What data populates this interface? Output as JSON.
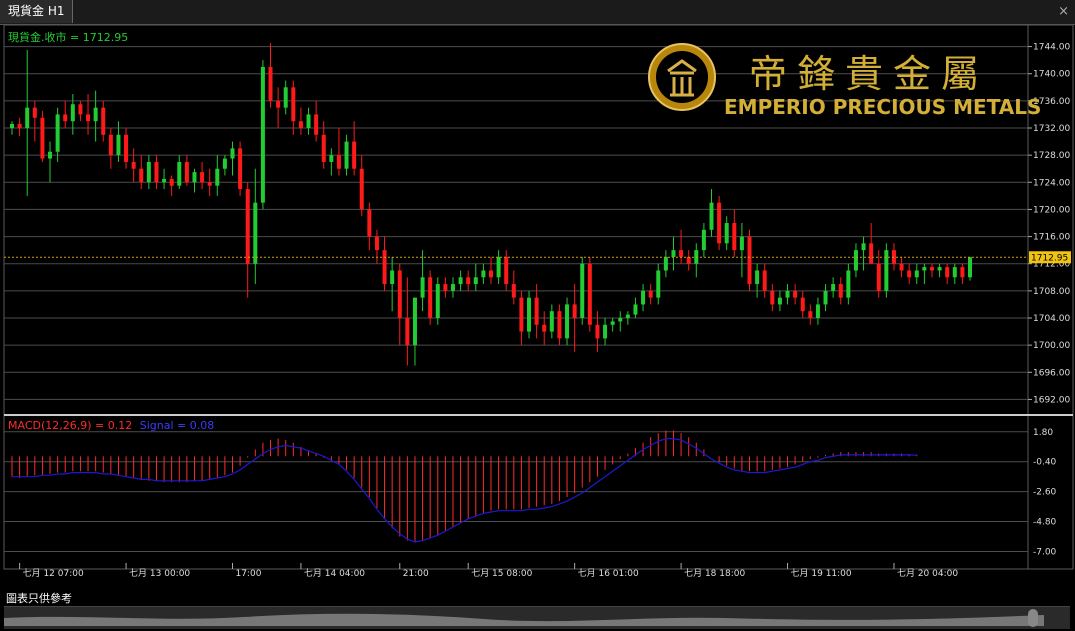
{
  "tab": {
    "title": "現貨金 H1"
  },
  "window": {
    "close_glyph": "×"
  },
  "disclaimer": "圖表只供參考",
  "logo": {
    "chinese": "帝鋒貴金屬",
    "english": "EMPERIO PRECIOUS METALS"
  },
  "colors": {
    "up": "#22cc33",
    "down": "#ff1a1a",
    "grid": "#4d4d4d",
    "price_line": "#d4a017",
    "macd_hist": "#ff2a2a",
    "signal": "#1a1ad4"
  },
  "chart_data": [
    {
      "type": "candlestick",
      "title": "現貨金.收市 = 1712.95",
      "current_price": 1712.95,
      "current_price_label": "1712.95",
      "ylim": [
        1690,
        1746
      ],
      "y_ticks": [
        1744,
        1740,
        1736,
        1732,
        1728,
        1724,
        1720,
        1716,
        1712,
        1708,
        1704,
        1700,
        1696,
        1692
      ],
      "y_tick_labels": [
        "1744.00",
        "1740.00",
        "1736.00",
        "1732.00",
        "1728.00",
        "1724.00",
        "1720.00",
        "1716.00",
        "1712.00",
        "1708.00",
        "1704.00",
        "1700.00",
        "1696.00",
        "1692.00"
      ],
      "x_labels": [
        "七月 12 07:00",
        "七月 13 00:00",
        "17:00",
        "七月 14 04:00",
        "21:00",
        "七月 15 08:00",
        "七月 16 01:00",
        "七月 18 18:00",
        "七月 19 11:00",
        "七月 20 04:00"
      ],
      "x_label_bars": [
        1,
        15,
        29,
        38,
        51,
        60,
        74,
        88,
        102,
        116
      ],
      "ohlc": [
        [
          1732,
          1733,
          1731,
          1732.6
        ],
        [
          1732.6,
          1733.5,
          1730.8,
          1732
        ],
        [
          1732,
          1743.5,
          1722,
          1735
        ],
        [
          1735,
          1736,
          1730,
          1733.5
        ],
        [
          1733.5,
          1734.5,
          1727,
          1727.5
        ],
        [
          1727.5,
          1730,
          1724,
          1728.5
        ],
        [
          1728.5,
          1735,
          1727,
          1734
        ],
        [
          1734,
          1736,
          1732,
          1733
        ],
        [
          1733,
          1737,
          1731,
          1735.5
        ],
        [
          1735.5,
          1736,
          1733,
          1734
        ],
        [
          1734,
          1737,
          1731,
          1733
        ],
        [
          1733,
          1737.5,
          1730,
          1735
        ],
        [
          1735,
          1736,
          1730,
          1731
        ],
        [
          1731,
          1732,
          1726,
          1728
        ],
        [
          1728,
          1733,
          1727,
          1731
        ],
        [
          1731,
          1732,
          1726,
          1727
        ],
        [
          1727,
          1729,
          1724,
          1726
        ],
        [
          1726,
          1728,
          1723,
          1724
        ],
        [
          1724,
          1728,
          1723,
          1727
        ],
        [
          1727,
          1728,
          1723,
          1724
        ],
        [
          1724,
          1726,
          1723,
          1724.5
        ],
        [
          1724.5,
          1725,
          1722,
          1723.5
        ],
        [
          1723.5,
          1728,
          1723,
          1727
        ],
        [
          1727,
          1728,
          1723.5,
          1724
        ],
        [
          1724,
          1726,
          1722.5,
          1725.5
        ],
        [
          1725.5,
          1727,
          1723,
          1724
        ],
        [
          1724,
          1726,
          1722,
          1723.5
        ],
        [
          1723.5,
          1728,
          1722,
          1726
        ],
        [
          1726,
          1728,
          1725,
          1727.5
        ],
        [
          1727.5,
          1730,
          1725,
          1729
        ],
        [
          1729,
          1730,
          1722,
          1723
        ],
        [
          1723,
          1724,
          1707,
          1712
        ],
        [
          1712,
          1726,
          1709,
          1721
        ],
        [
          1721,
          1742,
          1720,
          1741
        ],
        [
          1741,
          1744.5,
          1735,
          1736
        ],
        [
          1736,
          1738,
          1732,
          1735
        ],
        [
          1735,
          1739,
          1734,
          1738
        ],
        [
          1738,
          1739,
          1731,
          1733
        ],
        [
          1733,
          1735,
          1731,
          1732
        ],
        [
          1732,
          1735,
          1731,
          1734
        ]
      ],
      "ohlc_continued": [
        [
          1734,
          1736,
          1730,
          1731
        ],
        [
          1731,
          1733,
          1726,
          1727
        ],
        [
          1727,
          1729,
          1725,
          1728
        ],
        [
          1728,
          1732,
          1725,
          1726
        ],
        [
          1726,
          1731,
          1725,
          1730
        ],
        [
          1730,
          1733,
          1725,
          1726
        ],
        [
          1726,
          1728,
          1719,
          1720
        ],
        [
          1720,
          1721,
          1714,
          1716
        ],
        [
          1716,
          1717,
          1712,
          1714
        ],
        [
          1714,
          1716,
          1708,
          1709
        ],
        [
          1709,
          1713,
          1705,
          1711
        ],
        [
          1711,
          1712,
          1700,
          1704
        ],
        [
          1704,
          1710,
          1697,
          1700
        ],
        [
          1700,
          1707,
          1697,
          1707
        ],
        [
          1707,
          1714,
          1705,
          1710
        ],
        [
          1710,
          1711,
          1703,
          1704
        ],
        [
          1704,
          1710,
          1703,
          1709
        ],
        [
          1709,
          1710,
          1707,
          1708
        ],
        [
          1708,
          1710,
          1707,
          1709
        ],
        [
          1709,
          1711,
          1708,
          1710
        ],
        [
          1710,
          1711,
          1708,
          1709
        ],
        [
          1709,
          1712,
          1708,
          1710
        ],
        [
          1710,
          1712,
          1709,
          1711
        ],
        [
          1711,
          1713,
          1709,
          1710
        ],
        [
          1710,
          1714,
          1709,
          1713
        ],
        [
          1713,
          1714,
          1708,
          1709
        ],
        [
          1709,
          1711,
          1706,
          1707
        ],
        [
          1707,
          1708,
          1700,
          1702
        ],
        [
          1702,
          1708,
          1701,
          1707
        ],
        [
          1707,
          1709,
          1701,
          1703
        ],
        [
          1703,
          1705,
          1700,
          1702
        ],
        [
          1702,
          1706,
          1701,
          1705
        ],
        [
          1705,
          1706,
          1700,
          1701
        ],
        [
          1701,
          1707,
          1700,
          1706
        ],
        [
          1706,
          1709,
          1699,
          1704
        ],
        [
          1704,
          1713,
          1703,
          1712
        ],
        [
          1712,
          1713,
          1702,
          1703
        ],
        [
          1703,
          1705,
          1699,
          1701
        ],
        [
          1701,
          1704,
          1700,
          1703
        ],
        [
          1703,
          1704,
          1702,
          1703.5
        ],
        [
          1703.5,
          1705,
          1702,
          1704
        ],
        [
          1704,
          1705,
          1703,
          1704.5
        ],
        [
          1704.5,
          1707,
          1704,
          1706
        ],
        [
          1706,
          1709,
          1705,
          1708
        ],
        [
          1708,
          1709,
          1706,
          1707
        ]
      ],
      "ohlc_tail": [
        [
          1707,
          1712,
          1706,
          1711
        ],
        [
          1711,
          1714,
          1710,
          1713
        ],
        [
          1713,
          1716,
          1711,
          1714
        ],
        [
          1714,
          1717,
          1712,
          1713
        ],
        [
          1713,
          1714,
          1711,
          1712
        ],
        [
          1712,
          1715,
          1710,
          1714
        ],
        [
          1714,
          1718,
          1713,
          1717
        ],
        [
          1717,
          1723,
          1716,
          1721
        ],
        [
          1721,
          1722,
          1714,
          1715
        ],
        [
          1715,
          1719,
          1714,
          1718
        ],
        [
          1718,
          1720,
          1713,
          1714
        ],
        [
          1714,
          1718,
          1710,
          1716
        ],
        [
          1716,
          1717,
          1708,
          1709
        ],
        [
          1709,
          1712,
          1707,
          1711
        ],
        [
          1711,
          1712,
          1707,
          1708
        ],
        [
          1708,
          1709,
          1705,
          1706
        ],
        [
          1706,
          1708,
          1705,
          1707
        ],
        [
          1707,
          1709,
          1706,
          1708
        ],
        [
          1708,
          1709,
          1706,
          1707
        ],
        [
          1707,
          1708,
          1704,
          1705
        ],
        [
          1705,
          1706,
          1703,
          1704
        ],
        [
          1704,
          1707,
          1703,
          1706
        ],
        [
          1706,
          1709,
          1705,
          1708
        ],
        [
          1708,
          1710,
          1707,
          1709
        ],
        [
          1709,
          1710,
          1706,
          1707
        ],
        [
          1707,
          1712,
          1706,
          1711
        ],
        [
          1711,
          1715,
          1710,
          1714
        ],
        [
          1714,
          1716,
          1711,
          1715
        ],
        [
          1715,
          1718,
          1713,
          1712
        ],
        [
          1712,
          1714,
          1707,
          1708
        ],
        [
          1708,
          1715,
          1707,
          1714
        ],
        [
          1714,
          1715,
          1711,
          1712
        ],
        [
          1712,
          1713,
          1710,
          1711
        ],
        [
          1711,
          1712,
          1709,
          1710
        ],
        [
          1710,
          1712,
          1709,
          1711
        ],
        [
          1711,
          1712,
          1709,
          1711.5
        ],
        [
          1711.5,
          1712,
          1710,
          1711
        ],
        [
          1711,
          1712,
          1710,
          1711.5
        ],
        [
          1711.5,
          1712,
          1709,
          1710
        ],
        [
          1710,
          1712,
          1709,
          1711.5
        ],
        [
          1711.5,
          1712,
          1709,
          1710
        ],
        [
          1710,
          1713,
          1709.5,
          1712.95
        ]
      ]
    },
    {
      "type": "bar+line",
      "title_macd": "MACD(12,26,9) = 0.12",
      "title_signal": "Signal = 0.08",
      "ylim": [
        -7.7,
        2.3
      ],
      "y_ticks": [
        1.8,
        -0.4,
        -2.6,
        -4.8,
        -7.0
      ],
      "y_tick_labels": [
        "1.80",
        "-0.40",
        "-2.60",
        "-4.80",
        "-7.00"
      ],
      "series": [
        {
          "name": "MACD",
          "values": [
            -1.5,
            -1.6,
            -1.5,
            -1.4,
            -1.4,
            -1.3,
            -1.2,
            -1.2,
            -1.1,
            -1.1,
            -1.1,
            -1.1,
            -1.2,
            -1.3,
            -1.4,
            -1.5,
            -1.6,
            -1.7,
            -1.8,
            -1.8,
            -1.9,
            -1.9,
            -1.9,
            -1.9,
            -1.8,
            -1.8,
            -1.7,
            -1.6,
            -1.4,
            -1.2,
            -0.7,
            -0.1,
            0.5,
            1.0,
            1.2,
            1.3,
            1.2,
            1.0,
            0.7,
            0.4,
            0.2,
            -0.1,
            -0.3,
            -0.6,
            -1.0,
            -1.6,
            -2.3,
            -3.0,
            -3.8,
            -4.6,
            -5.3,
            -5.9,
            -6.2,
            -6.3,
            -6.2,
            -6.0,
            -5.8,
            -5.5,
            -5.2,
            -4.9,
            -4.6,
            -4.4,
            -4.2,
            -4.0,
            -3.9,
            -3.9,
            -3.9,
            -3.9,
            -3.8,
            -3.7,
            -3.6,
            -3.5,
            -3.3,
            -3.0,
            -2.7,
            -2.3,
            -1.9,
            -1.5,
            -1.0,
            -0.6,
            -0.2,
            0.2,
            0.6,
            1.0,
            1.4,
            1.7,
            1.9,
            1.9,
            1.7,
            1.4,
            1.0,
            0.5,
            0.0,
            -0.4,
            -0.7,
            -0.9,
            -1.1,
            -1.1,
            -1.1,
            -1.1,
            -1.0,
            -0.9,
            -0.8,
            -0.6,
            -0.4,
            -0.2,
            -0.1,
            0.1,
            0.2,
            0.3,
            0.3,
            0.3,
            0.3,
            0.3,
            0.2,
            0.2,
            0.2,
            0.2,
            0.15,
            0.12
          ]
        },
        {
          "name": "Signal",
          "values": [
            -1.5,
            -1.5,
            -1.5,
            -1.5,
            -1.4,
            -1.4,
            -1.3,
            -1.3,
            -1.2,
            -1.2,
            -1.2,
            -1.2,
            -1.3,
            -1.3,
            -1.4,
            -1.5,
            -1.6,
            -1.7,
            -1.7,
            -1.8,
            -1.8,
            -1.8,
            -1.8,
            -1.8,
            -1.8,
            -1.8,
            -1.7,
            -1.6,
            -1.5,
            -1.3,
            -1.0,
            -0.6,
            -0.2,
            0.2,
            0.5,
            0.7,
            0.8,
            0.7,
            0.6,
            0.4,
            0.2,
            0.0,
            -0.3,
            -0.6,
            -1.1,
            -1.7,
            -2.4,
            -3.1,
            -3.9,
            -4.6,
            -5.2,
            -5.7,
            -6.1,
            -6.3,
            -6.2,
            -6.0,
            -5.8,
            -5.5,
            -5.2,
            -4.9,
            -4.6,
            -4.4,
            -4.2,
            -4.1,
            -4.0,
            -4.0,
            -4.0,
            -4.0,
            -3.9,
            -3.9,
            -3.8,
            -3.7,
            -3.5,
            -3.3,
            -3.0,
            -2.7,
            -2.3,
            -1.9,
            -1.5,
            -1.1,
            -0.7,
            -0.3,
            0.1,
            0.5,
            0.8,
            1.1,
            1.3,
            1.3,
            1.2,
            0.9,
            0.6,
            0.2,
            -0.2,
            -0.5,
            -0.8,
            -1.0,
            -1.1,
            -1.2,
            -1.2,
            -1.2,
            -1.1,
            -1.0,
            -0.9,
            -0.8,
            -0.6,
            -0.4,
            -0.3,
            -0.1,
            0.0,
            0.1,
            0.1,
            0.1,
            0.1,
            0.1,
            0.1,
            0.1,
            0.1,
            0.1,
            0.1,
            0.08
          ]
        }
      ]
    }
  ]
}
